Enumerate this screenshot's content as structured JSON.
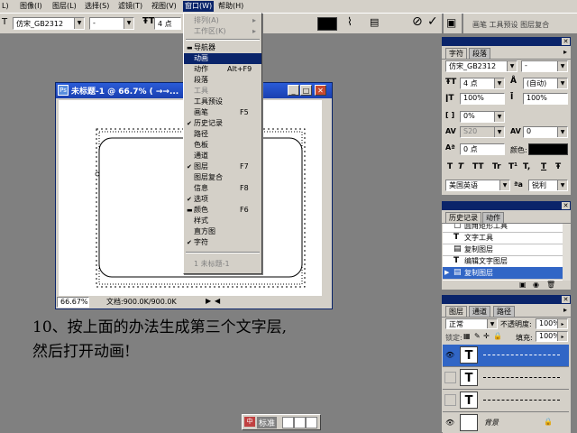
{
  "menubar": {
    "items": [
      "图像(I)",
      "图层(L)",
      "选择(S)",
      "滤镜(T)",
      "视图(V)",
      "窗口(W)",
      "帮助(H)"
    ],
    "active_index": 5,
    "left_fragment": "L)"
  },
  "options_bar": {
    "font_family": "仿宋_GB2312",
    "font_style": "-",
    "font_size": "4 点",
    "palettes_button": "画笔 工具预设 图层复合"
  },
  "window_menu": {
    "items": [
      {
        "label": "排列(A)",
        "shortcut": "",
        "mark": "",
        "disabled": true,
        "submenu": true
      },
      {
        "label": "工作区(K)",
        "shortcut": "",
        "mark": "",
        "disabled": true,
        "submenu": true
      },
      {
        "label": "导航器",
        "shortcut": "",
        "mark": "dash",
        "disabled": false
      },
      {
        "label": "动画",
        "shortcut": "",
        "mark": "",
        "disabled": false,
        "highlight": true
      },
      {
        "label": "动作",
        "shortcut": "Alt+F9",
        "mark": "",
        "disabled": false
      },
      {
        "label": "段落",
        "shortcut": "",
        "mark": "",
        "disabled": false
      },
      {
        "label": "工具",
        "shortcut": "",
        "mark": "",
        "disabled": true
      },
      {
        "label": "工具预设",
        "shortcut": "",
        "mark": "",
        "disabled": false
      },
      {
        "label": "画笔",
        "shortcut": "F5",
        "mark": "",
        "disabled": false
      },
      {
        "label": "历史记录",
        "shortcut": "",
        "mark": "check",
        "disabled": false
      },
      {
        "label": "路径",
        "shortcut": "",
        "mark": "",
        "disabled": false
      },
      {
        "label": "色板",
        "shortcut": "",
        "mark": "",
        "disabled": false
      },
      {
        "label": "通道",
        "shortcut": "",
        "mark": "",
        "disabled": false
      },
      {
        "label": "图层",
        "shortcut": "F7",
        "mark": "check",
        "disabled": false
      },
      {
        "label": "图层复合",
        "shortcut": "",
        "mark": "",
        "disabled": false
      },
      {
        "label": "信息",
        "shortcut": "F8",
        "mark": "",
        "disabled": false
      },
      {
        "label": "选项",
        "shortcut": "",
        "mark": "check",
        "disabled": false
      },
      {
        "label": "颜色",
        "shortcut": "F6",
        "mark": "dash",
        "disabled": false
      },
      {
        "label": "样式",
        "shortcut": "",
        "mark": "",
        "disabled": false
      },
      {
        "label": "直方图",
        "shortcut": "",
        "mark": "",
        "disabled": false
      },
      {
        "label": "字符",
        "shortcut": "",
        "mark": "check",
        "disabled": false
      }
    ],
    "recent_doc": "1 未标题-1"
  },
  "document": {
    "title": "未标题-1 @ 66.7% ( →→...",
    "zoom": "66.67%",
    "doc_info": "文档:900.0K/900.0K",
    "icon": "photoshop-doc-icon"
  },
  "character_panel": {
    "tabs": [
      "字符",
      "段落"
    ],
    "font_family": "仿宋_GB2312",
    "font_style": "-",
    "font_size": "4 点",
    "leading": "(自动)",
    "vertical_scale": "100%",
    "horizontal_scale": "100%",
    "kerning_ratio": "0%",
    "kerning": "S20",
    "tracking": "0",
    "baseline_shift": "0 点",
    "color_label": "颜色:",
    "color_value": "#000000",
    "style_buttons": [
      "T",
      "T",
      "TT",
      "Tr",
      "T¹",
      "T,",
      "T",
      "Ŧ"
    ],
    "language": "美国英语",
    "antialias_label": "ªa",
    "antialias": "锐利"
  },
  "history_panel": {
    "tabs": [
      "历史记录",
      "动作"
    ],
    "items": [
      {
        "label": "圆角矩形工具",
        "icon": "rounded-rect-icon",
        "selected": false
      },
      {
        "label": "文字工具",
        "icon": "type-icon",
        "selected": false
      },
      {
        "label": "复制图层",
        "icon": "layer-icon",
        "selected": false
      },
      {
        "label": "编辑文字图层",
        "icon": "type-icon",
        "selected": false
      },
      {
        "label": "复制图层",
        "icon": "layer-icon",
        "selected": true
      }
    ]
  },
  "layers_panel": {
    "tabs": [
      "图层",
      "通道",
      "路径"
    ],
    "blend_mode": "正常",
    "opacity_label": "不透明度:",
    "opacity": "100%",
    "lock_label": "锁定:",
    "fill_label": "填充:",
    "fill": "100%",
    "layers": [
      {
        "type": "T",
        "selected": true,
        "visible": true
      },
      {
        "type": "T",
        "selected": false,
        "visible": false
      },
      {
        "type": "T",
        "selected": false,
        "visible": false
      },
      {
        "type": "bg",
        "name": "背景",
        "selected": false,
        "visible": true
      }
    ]
  },
  "caption": {
    "line1": "10、按上面的办法生成第三个文字层,",
    "line2": "然后打开动画!"
  },
  "taskbar": {
    "label": "标准"
  }
}
